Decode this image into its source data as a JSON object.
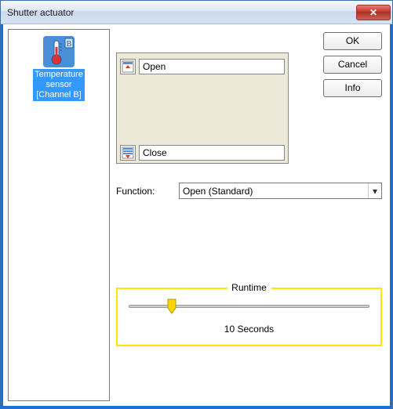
{
  "window": {
    "title": "Shutter actuator"
  },
  "buttons": {
    "ok": "OK",
    "cancel": "Cancel",
    "info": "Info",
    "close_window": "✕"
  },
  "sensor": {
    "label_line1": "Temperature",
    "label_line2": "sensor",
    "label_line3": "[Channel B]",
    "badge": "B"
  },
  "actions": {
    "open": "Open",
    "close": "Close"
  },
  "function_row": {
    "label": "Function:",
    "selected": "Open (Standard)"
  },
  "runtime": {
    "legend": "Runtime",
    "value_text": "10 Seconds",
    "thumb_percent": 18
  }
}
